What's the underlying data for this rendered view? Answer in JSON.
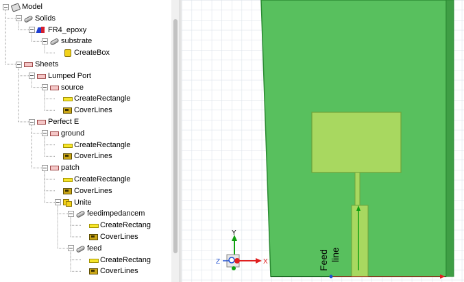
{
  "tree": {
    "nodes": [
      {
        "id": "model",
        "label": "Model",
        "icon": "model-icon",
        "level": 0,
        "expanded": true,
        "x": 0,
        "y": 12
      },
      {
        "id": "solids",
        "label": "Solids",
        "icon": "solids-icon",
        "level": 1,
        "expanded": true
      },
      {
        "id": "fr4",
        "label": "FR4_epoxy",
        "icon": "material-icon",
        "level": 2,
        "expanded": true
      },
      {
        "id": "substrate",
        "label": "substrate",
        "icon": "solid-object-icon",
        "level": 3,
        "expanded": true
      },
      {
        "id": "createbox",
        "label": "CreateBox",
        "icon": "create-box-icon",
        "level": 4
      },
      {
        "id": "sheets",
        "label": "Sheets",
        "icon": "sheet-icon",
        "level": 1,
        "expanded": true
      },
      {
        "id": "lumped",
        "label": "Lumped Port",
        "icon": "sheet-icon",
        "level": 2,
        "expanded": true
      },
      {
        "id": "source",
        "label": "source",
        "icon": "sheet-icon",
        "level": 3,
        "expanded": true
      },
      {
        "id": "src-rect",
        "label": "CreateRectangle",
        "icon": "create-rectangle-icon",
        "level": 4
      },
      {
        "id": "src-cover",
        "label": "CoverLines",
        "icon": "cover-lines-icon",
        "level": 4
      },
      {
        "id": "perfecte",
        "label": "Perfect E",
        "icon": "sheet-icon",
        "level": 2,
        "expanded": true
      },
      {
        "id": "ground",
        "label": "ground",
        "icon": "sheet-icon",
        "level": 3,
        "expanded": true
      },
      {
        "id": "gnd-rect",
        "label": "CreateRectangle",
        "icon": "create-rectangle-icon",
        "level": 4
      },
      {
        "id": "gnd-cover",
        "label": "CoverLines",
        "icon": "cover-lines-icon",
        "level": 4
      },
      {
        "id": "patch",
        "label": "patch",
        "icon": "sheet-icon",
        "level": 3,
        "expanded": true
      },
      {
        "id": "patch-rect",
        "label": "CreateRectangle",
        "icon": "create-rectangle-icon",
        "level": 4
      },
      {
        "id": "patch-cover",
        "label": "CoverLines",
        "icon": "cover-lines-icon",
        "level": 4
      },
      {
        "id": "unite",
        "label": "Unite",
        "icon": "unite-icon",
        "level": 4,
        "expanded": true
      },
      {
        "id": "feedimp",
        "label": "feedimpedancem",
        "icon": "solid-object-icon",
        "level": 5,
        "expanded": true
      },
      {
        "id": "fi-rect",
        "label": "CreateRectang",
        "icon": "create-rectangle-icon",
        "level": 6
      },
      {
        "id": "fi-cover",
        "label": "CoverLines",
        "icon": "cover-lines-icon",
        "level": 6
      },
      {
        "id": "feed",
        "label": "feed",
        "icon": "solid-object-icon",
        "level": 5,
        "expanded": true
      },
      {
        "id": "feed-rect",
        "label": "CreateRectang",
        "icon": "create-rectangle-icon",
        "level": 6
      },
      {
        "id": "feed-cover",
        "label": "CoverLines",
        "icon": "cover-lines-icon",
        "level": 6
      }
    ]
  },
  "viewport": {
    "annotation": {
      "line1": "Feed",
      "line2": "line"
    },
    "axes": {
      "x": "X",
      "y": "Y",
      "z": "Z"
    },
    "colors": {
      "substrate": "#58c05e",
      "substrate_edge": "#2a8a32",
      "patch": "#a8d860",
      "grid": "#d6dde6",
      "axis_x": "#e02020",
      "axis_y": "#10a010",
      "axis_z": "#2050d0"
    }
  }
}
